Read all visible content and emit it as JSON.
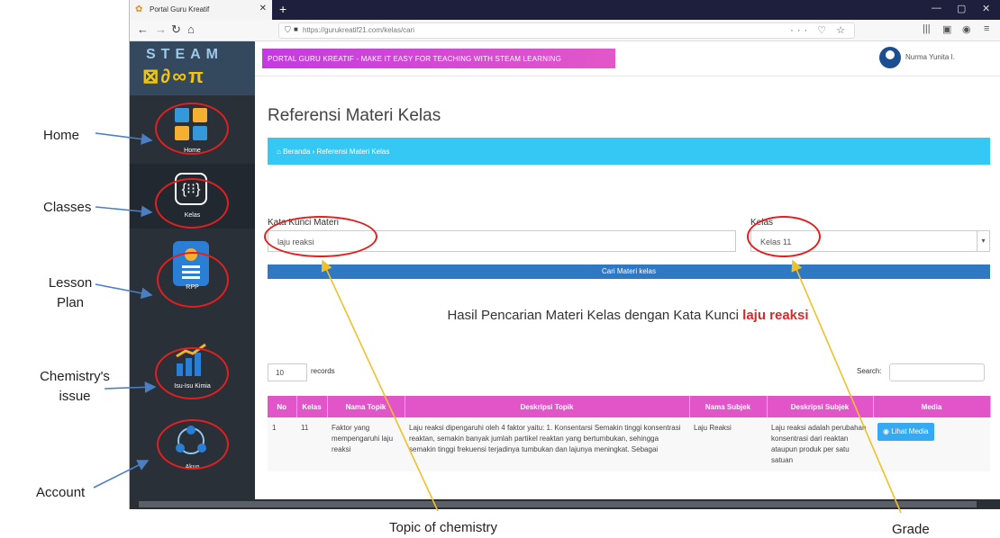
{
  "annotations": {
    "home": "Home",
    "classes": "Classes",
    "lesson_plan": "Lesson Plan",
    "chemistry_issue": "Chemistry's issue",
    "account": "Account",
    "topic": "Topic of chemistry",
    "grade": "Grade"
  },
  "browser": {
    "tab_title": "Portal Guru Kreatif",
    "url": "https://gurukreatif21.com/kelas/cari",
    "url_actions": "··· ♡ ☆"
  },
  "app": {
    "logo_top": "STEAM",
    "logo_bottom": "⊠∂∞π",
    "banner": "PORTAL GURU KREATIF - MAKE IT EASY FOR TEACHING WITH STEAM LEARNING",
    "user_name": "Nurma Yunita I."
  },
  "sidebar": {
    "items": [
      {
        "label": "Home",
        "icon": "home-icon"
      },
      {
        "label": "Kelas",
        "icon": "classes-icon"
      },
      {
        "label": "RPP",
        "icon": "lesson-plan-icon"
      },
      {
        "label": "Isu-Isu Kimia",
        "icon": "chart-icon"
      },
      {
        "label": "Akun",
        "icon": "account-icon"
      }
    ]
  },
  "page": {
    "title": "Referensi Materi Kelas",
    "breadcrumb_home": "Beranda",
    "breadcrumb_current": "Referensi Materi Kelas",
    "keyword_label": "Kata Kunci Materi",
    "keyword_value": "laju reaksi",
    "class_label": "Kelas",
    "class_value": "Kelas 11",
    "search_button": "Cari Materi kelas",
    "result_prefix": "Hasil Pencarian Materi Kelas dengan Kata Kunci",
    "result_keyword": "laju reaksi"
  },
  "table": {
    "records_value": "10",
    "records_label": "records",
    "search_label": "Search:",
    "headers": [
      "No",
      "Kelas",
      "Nama Topik",
      "Deskripsi Topik",
      "Nama Subjek",
      "Deskripsi Subjek",
      "Media"
    ],
    "rows": [
      {
        "no": "1",
        "kelas": "11",
        "nama_topik": "Faktor yang mempengaruhi laju reaksi",
        "deskripsi_topik": "Laju reaksi dipengaruhi oleh 4 faktor yaitu: 1. Konsentarsi Semakin tinggi konsentrasi reaktan, semakin banyak jumlah partikel reaktan yang bertumbukan, sehingga semakin tinggi frekuensi terjadinya tumbukan dan lajunya meningkat. Sebagai",
        "nama_subjek": "Laju Reaksi",
        "deskripsi_subjek": "Laju reaksi adalah perubahan konsentrasi dari reaktan ataupun produk per satu satuan",
        "media_button": "Lihat Media"
      }
    ]
  }
}
